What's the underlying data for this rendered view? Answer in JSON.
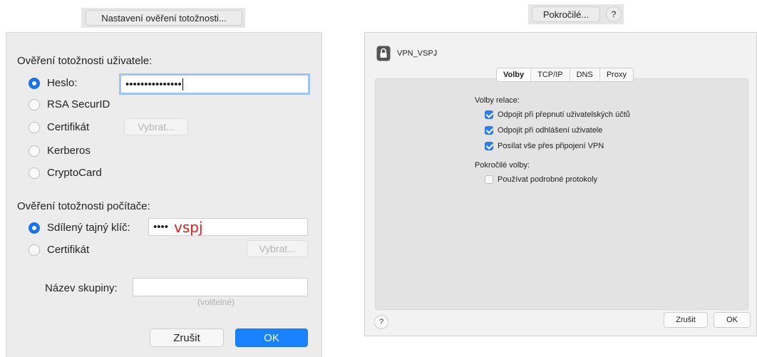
{
  "left": {
    "top_button_label": "Nastavení ověření totožnosti...",
    "user_auth_title": "Ověření totožnosti uživatele:",
    "user_options": [
      {
        "label": "Heslo:",
        "checked": true
      },
      {
        "label": "RSA SecurID",
        "checked": false
      },
      {
        "label": "Certifikát",
        "checked": false
      },
      {
        "label": "Kerberos",
        "checked": false
      },
      {
        "label": "CryptoCard",
        "checked": false
      }
    ],
    "password_value": "•••••••••••••••",
    "select_button_label": "Vybrat...",
    "computer_auth_title": "Ověření totožnosti počítače:",
    "computer_options": [
      {
        "label": "Sdílený tajný klíč:",
        "checked": true
      },
      {
        "label": "Certifikát",
        "checked": false
      }
    ],
    "shared_secret_dots": "••••",
    "shared_secret_annotation": "vspj",
    "annotation_color": "#e01b1b",
    "computer_select_button_label": "Vybrat...",
    "group_name_label": "Název skupiny:",
    "group_name_value": "",
    "group_name_hint": "(volitelné)",
    "cancel_label": "Zrušit",
    "ok_label": "OK",
    "accent_color": "#1a82ff"
  },
  "right": {
    "top_button_label": "Pokročilé...",
    "top_help_label": "?",
    "vpn_name": "VPN_VSPJ",
    "lock_icon": "lock-icon",
    "tabs": [
      "Volby",
      "TCP/IP",
      "DNS",
      "Proxy"
    ],
    "active_tab": "Volby",
    "session_options_title": "Volby relace:",
    "session_options": [
      {
        "label": "Odpojit při přepnutí uživatelských účtů",
        "checked": true
      },
      {
        "label": "Odpojit při odhlášení uživatele",
        "checked": true
      },
      {
        "label": "Posílat vše přes připojení VPN",
        "checked": true
      }
    ],
    "advanced_options_title": "Pokročilé volby:",
    "advanced_options": [
      {
        "label": "Používat podrobné protokoly",
        "checked": false
      }
    ],
    "help_label": "?",
    "cancel_label": "Zrušit",
    "ok_label": "OK"
  }
}
